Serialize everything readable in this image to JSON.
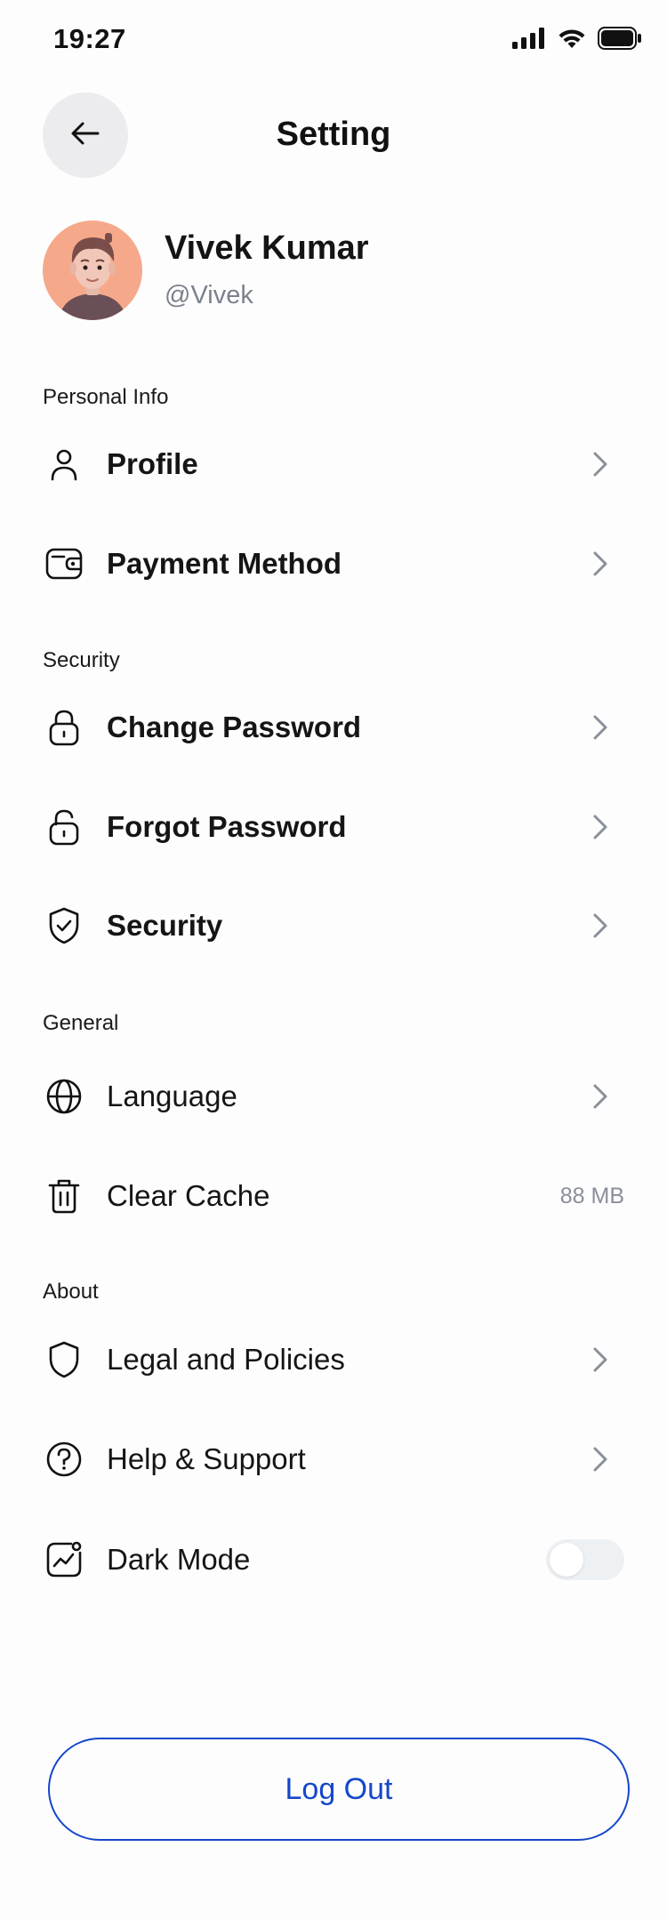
{
  "status_bar": {
    "time": "19:27",
    "icons": [
      "signal-icon",
      "wifi-icon",
      "battery-icon"
    ]
  },
  "header": {
    "title": "Setting",
    "back_icon": "arrow-left-icon"
  },
  "profile": {
    "name": "Vivek Kumar",
    "handle": "@Vivek"
  },
  "sections": {
    "personal_info": {
      "label": "Personal Info",
      "items": [
        {
          "label": "Profile",
          "icon": "user-icon"
        },
        {
          "label": "Payment Method",
          "icon": "wallet-icon"
        }
      ]
    },
    "security": {
      "label": "Security",
      "items": [
        {
          "label": "Change Password",
          "icon": "lock-icon"
        },
        {
          "label": "Forgot Password",
          "icon": "unlock-icon"
        },
        {
          "label": "Security",
          "icon": "shield-check-icon"
        }
      ]
    },
    "general": {
      "label": "General",
      "items": [
        {
          "label": "Language",
          "icon": "globe-icon"
        },
        {
          "label": "Clear Cache",
          "icon": "trash-icon",
          "value": "88 MB"
        }
      ]
    },
    "about": {
      "label": "About",
      "items": [
        {
          "label": "Legal and Policies",
          "icon": "shield-icon"
        },
        {
          "label": "Help & Support",
          "icon": "help-circle-icon"
        },
        {
          "label": "Dark Mode",
          "icon": "chart-icon",
          "toggle_on": false
        }
      ]
    }
  },
  "logout": {
    "label": "Log Out"
  },
  "colors": {
    "accent": "#1447C9",
    "back_button_bg": "#ECECEE",
    "avatar_bg": "#F6A98A",
    "muted_text": "#7B818C"
  }
}
